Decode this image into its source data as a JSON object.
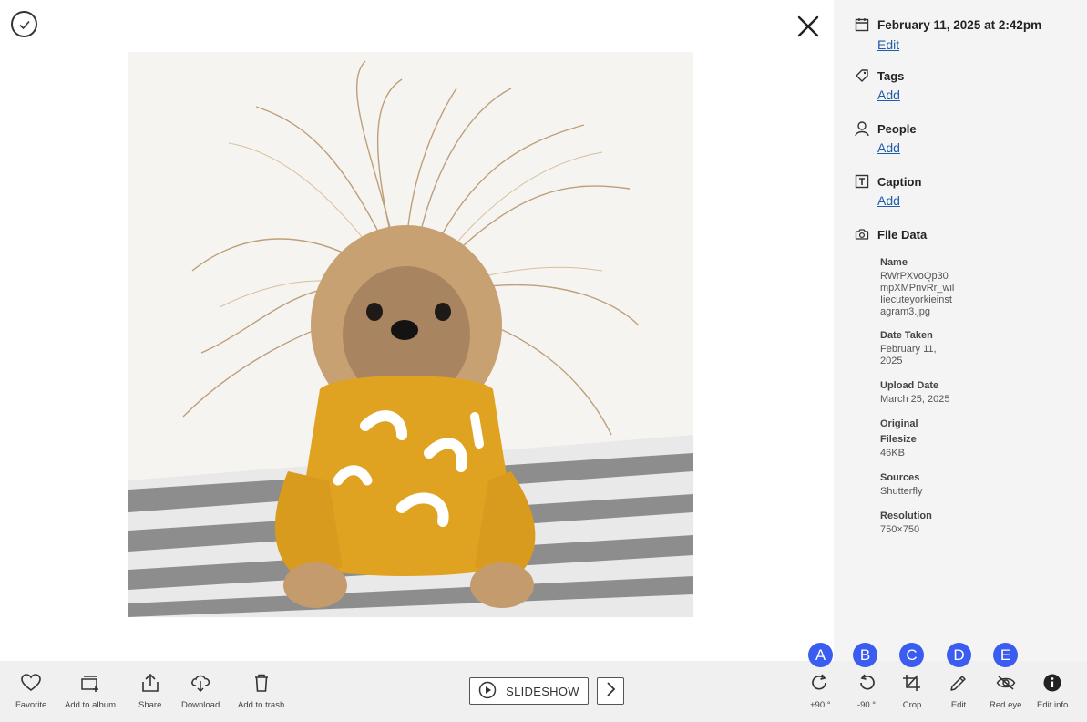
{
  "header": {
    "close_label": "Close"
  },
  "photo": {
    "alt": "Yorkie dog with windblown hair wearing a yellow sweater"
  },
  "sidebar": {
    "date": {
      "value": "February 11, 2025 at 2:42pm",
      "action": "Edit"
    },
    "tags": {
      "title": "Tags",
      "action": "Add"
    },
    "people": {
      "title": "People",
      "action": "Add"
    },
    "caption": {
      "title": "Caption",
      "action": "Add"
    },
    "file_data": {
      "title": "File Data",
      "name_label": "Name",
      "name_value": "RWrPXvoQp30mpXMPnvRr_wilIiecuteyorkieinstagram3.jpg",
      "date_taken_label": "Date Taken",
      "date_taken_value": "February 11, 2025",
      "upload_date_label": "Upload Date",
      "upload_date_value": "March 25, 2025",
      "original_filesize_label": "Original Filesize",
      "original_filesize_value": "46KB",
      "sources_label": "Sources",
      "sources_value": "Shutterfly",
      "resolution_label": "Resolution",
      "resolution_value": "750×750"
    }
  },
  "toolbar": {
    "favorite": "Favorite",
    "add_to_album": "Add to album",
    "share": "Share",
    "download": "Download",
    "add_to_trash": "Add to trash",
    "slideshow": "SLIDESHOW",
    "rotate_cw": "+90 °",
    "rotate_ccw": "-90 °",
    "crop": "Crop",
    "edit": "Edit",
    "red_eye": "Red eye",
    "edit_info": "Edit info"
  },
  "badges": [
    "A",
    "B",
    "C",
    "D",
    "E"
  ],
  "colors": {
    "link": "#1f5da8",
    "badge": "#3b5cf0",
    "sidebar_bg": "#f4f4f4",
    "toolbar_bg": "#f0f0f0"
  }
}
